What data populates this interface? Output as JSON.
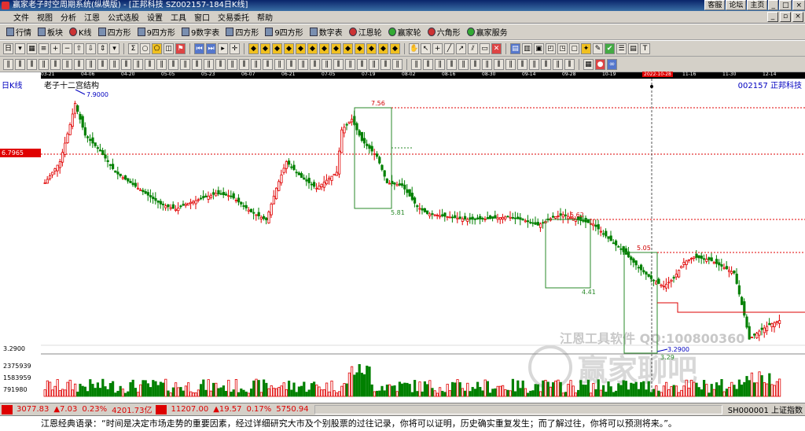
{
  "window": {
    "title": "赢家老子时空周期系统(纵横版) - [正邦科技  SZ002157-184日K线]",
    "right_buttons": [
      "客服",
      "论坛",
      "主页"
    ]
  },
  "menu": [
    "文件",
    "视图",
    "分析",
    "江恩",
    "公式选股",
    "设置",
    "工具",
    "窗口",
    "交易委托",
    "帮助"
  ],
  "toolbar1": [
    {
      "label": "行情",
      "icon": "quote-icon"
    },
    {
      "label": "板块",
      "icon": "sector-icon"
    },
    {
      "label": "K线",
      "icon": "kline-icon"
    },
    {
      "label": "四方形",
      "icon": "square-icon"
    },
    {
      "label": "9四方形",
      "icon": "square9-icon"
    },
    {
      "label": "9数字表",
      "icon": "number-table-icon"
    },
    {
      "label": "四方形",
      "icon": "square-icon"
    },
    {
      "label": "9四方形",
      "icon": "square9-icon"
    },
    {
      "label": "数字表",
      "icon": "number-table-icon"
    },
    {
      "label": "江恩轮",
      "icon": "gann-wheel-icon"
    },
    {
      "label": "赢家轮",
      "icon": "winner-wheel-icon"
    },
    {
      "label": "六角形",
      "icon": "hexagon-icon"
    },
    {
      "label": "赢家服务",
      "icon": "service-icon"
    }
  ],
  "chart": {
    "period_label": "日K线",
    "indicator_title": "老子十二宫结构",
    "stock_code_label": "002157  正邦科技",
    "current_date_marker": "2022-10-28",
    "price_marker": "6.7965",
    "bottom_price_label": "3.2900",
    "volume_labels": [
      "2375939",
      "1583959",
      "791980"
    ],
    "watermark_text": "江恩工具软件  QQ:100800360",
    "watermark_brand": "赢家聊吧",
    "dates": [
      "03-21",
      "04-06",
      "04-20",
      "05-05",
      "05-23",
      "06-07",
      "06-21",
      "07-05",
      "07-19",
      "08-02",
      "08-16",
      "08-30",
      "09-14",
      "09-28",
      "10-19",
      "2022-10-28",
      "11-16",
      "11-30",
      "12-14"
    ],
    "annotations": {
      "high_label": "7.9000",
      "box1_top": "7.56",
      "box1_bottom": "5.81",
      "box2_top": "5.62",
      "box2_bottom": "4.41",
      "box3_top": "5.05",
      "box3_bottom": "3.29",
      "low_label": "3.2900"
    }
  },
  "status": {
    "sh_index": "3077.83",
    "sh_change": "▲7.03",
    "sh_pct": "0.23%",
    "sh_amount": "4201.73亿",
    "sz_index": "11207.00",
    "sz_change": "▲19.57",
    "sz_pct": "0.17%",
    "sz_amount": "5750.94",
    "market_label": "SH000001 上证指数"
  },
  "quote_text": "江恩经典语录：“时间是决定市场走势的重要因素，经过详细研究大市及个别股票的过往记录，你将可以证明，历史确实重复发生；而了解过往，你将可以预测将来。”。"
}
